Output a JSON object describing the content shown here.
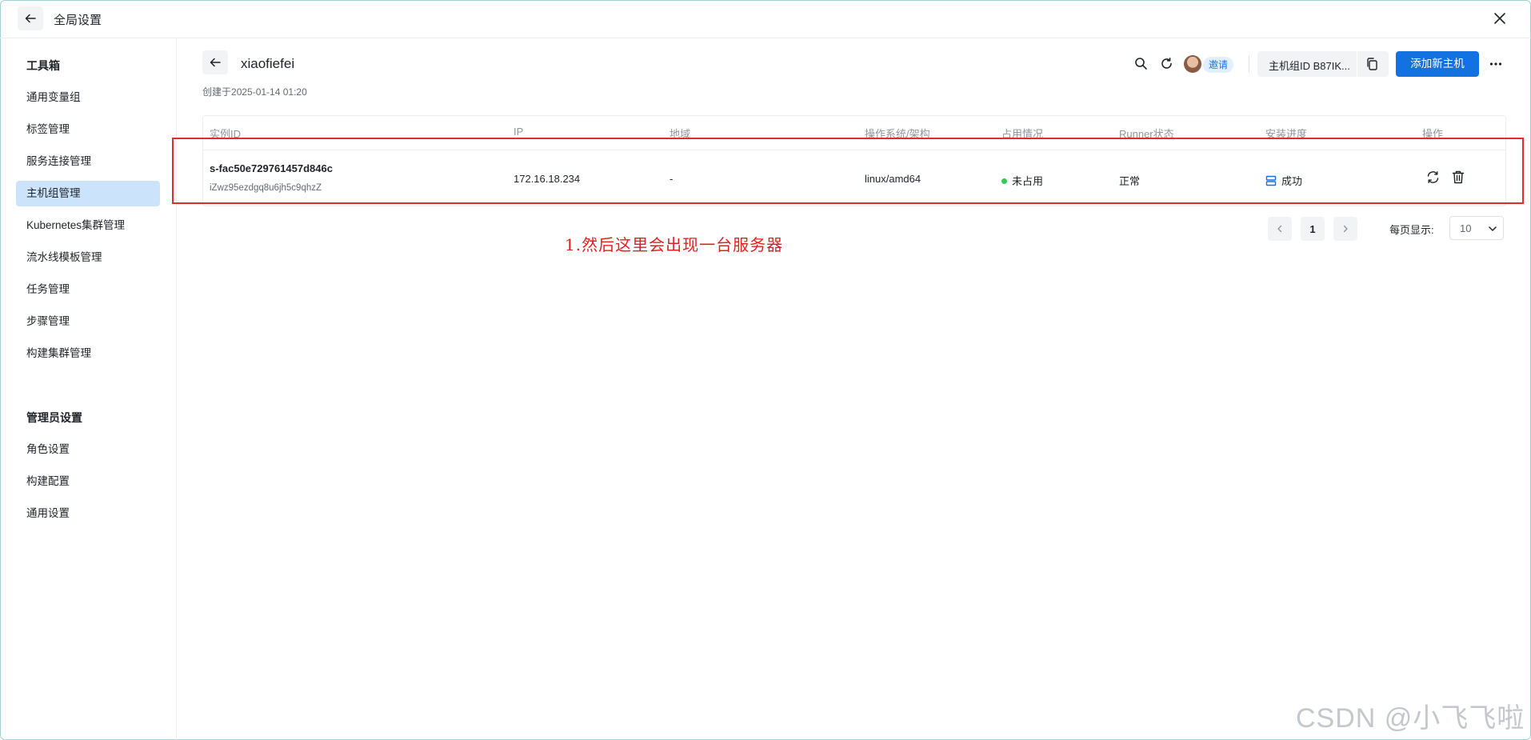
{
  "window": {
    "title": "全局设置"
  },
  "sidebar": {
    "group1": "工具箱",
    "items1": [
      "通用变量组",
      "标签管理",
      "服务连接管理",
      "主机组管理",
      "Kubernetes集群管理",
      "流水线模板管理",
      "任务管理",
      "步骤管理",
      "构建集群管理"
    ],
    "active_index": 3,
    "group2": "管理员设置",
    "items2": [
      "角色设置",
      "构建配置",
      "通用设置"
    ]
  },
  "header": {
    "title": "xiaofiefei",
    "created_prefix": "创建于",
    "created_time": "2025-01-14 01:20",
    "invite_label": "邀请",
    "group_id_label": "主机组ID B87IK...",
    "add_button": "添加新主机"
  },
  "table": {
    "columns": [
      "实例ID",
      "IP",
      "地域",
      "操作系统/架构",
      "占用情况",
      "Runner状态",
      "安装进度",
      "操作"
    ],
    "rows": [
      {
        "instance_id": "s-fac50e729761457d846c",
        "instance_sub": "iZwz95ezdgq8u6jh5c9qhzZ",
        "ip": "172.16.18.234",
        "region": "-",
        "os_arch": "linux/amd64",
        "occupancy": "未占用",
        "runner_status": "正常",
        "install_progress": "成功"
      }
    ]
  },
  "pagination": {
    "current_page": "1",
    "page_size_label": "每页显示:",
    "page_size": "10"
  },
  "annotation": "1.然后这里会出现一台服务器",
  "watermark": "CSDN @小飞飞啦",
  "colors": {
    "primary": "#1472e0",
    "active_bg": "#cce4fb",
    "highlight": "#e32b2b",
    "status_green": "#34c759"
  }
}
